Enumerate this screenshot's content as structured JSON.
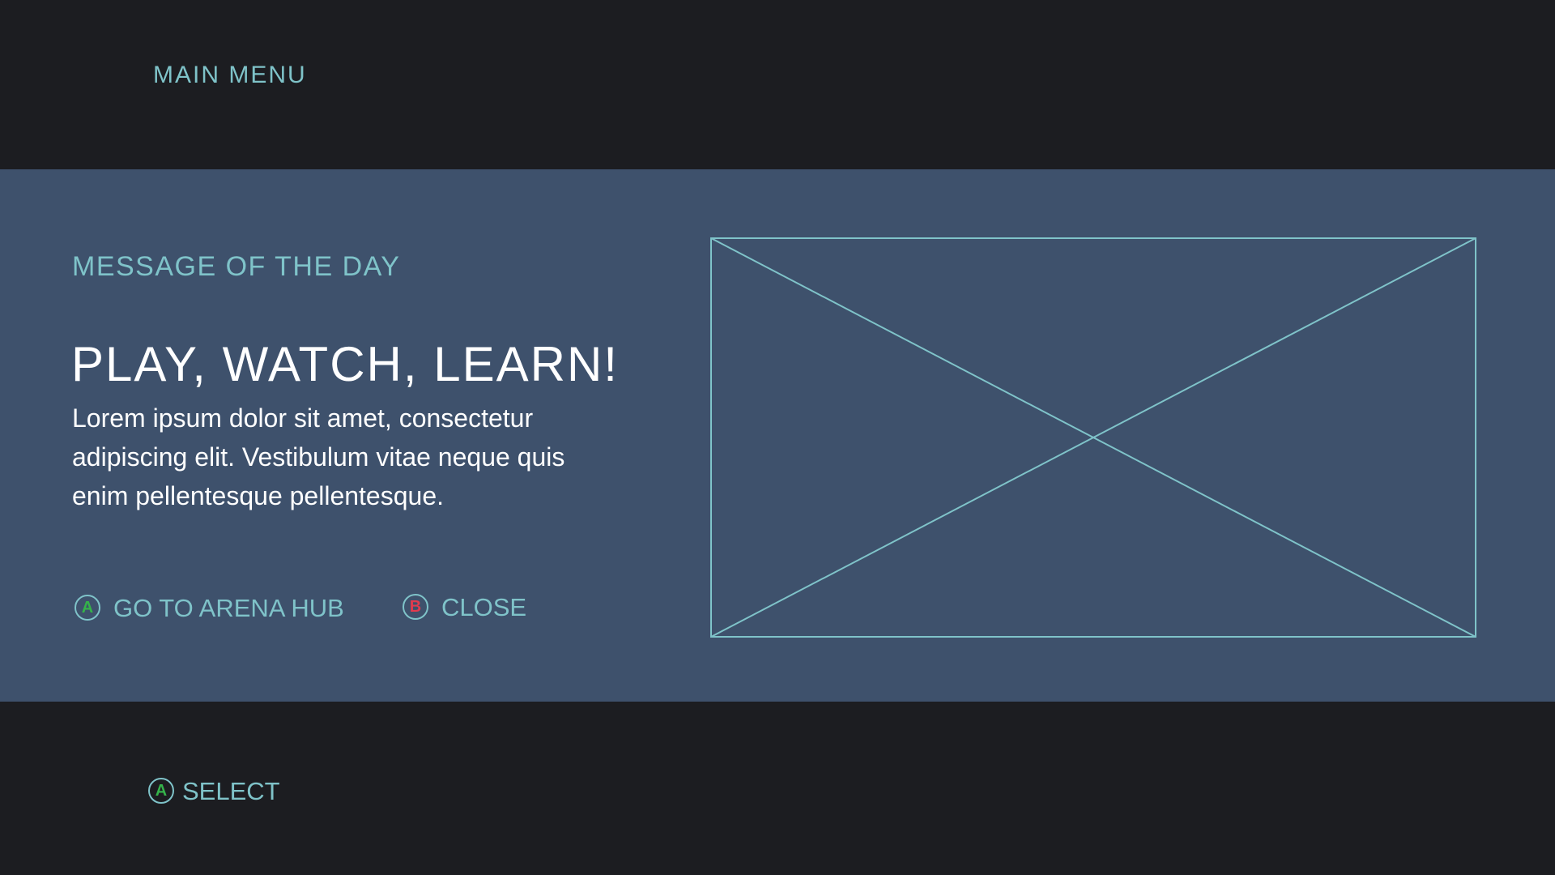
{
  "header": {
    "title": "MAIN MENU"
  },
  "motd": {
    "label": "MESSAGE OF THE DAY",
    "headline": "PLAY, WATCH, LEARN!",
    "body": "Lorem ipsum dolor sit amet, consectetur adipiscing elit. Vestibulum vitae neque quis enim pellentesque pellentesque.",
    "actions": [
      {
        "button": "A",
        "label": "GO TO ARENA HUB",
        "button_color": "#35b24a"
      },
      {
        "button": "B",
        "label": "CLOSE",
        "button_color": "#e23b4e"
      }
    ],
    "image": {
      "icon": "image-placeholder-icon"
    }
  },
  "footer": {
    "hint_button": "A",
    "hint_label": "SELECT"
  },
  "colors": {
    "background": "#1c1d21",
    "band": "#3e516c",
    "accent": "#7fc3c9",
    "text": "#ffffff"
  }
}
